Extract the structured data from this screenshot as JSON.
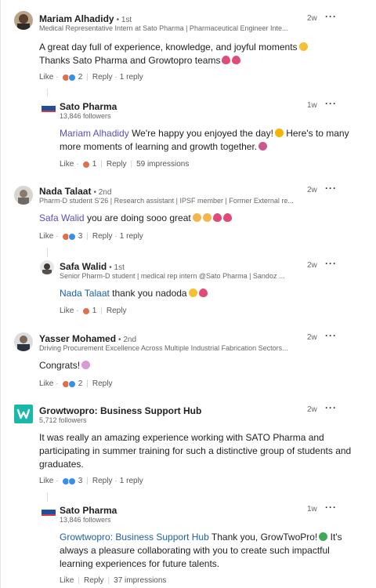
{
  "comments": [
    {
      "name": "Mariam Alhadidy",
      "degree": "• 1st",
      "headline": "Medical Representative Intern at Sato Pharma | Pharmaceutical Engineer Inte...",
      "time": "2w",
      "line1": "A great day full of experience, knowledge, and joyful moments",
      "line2": "Thanks Sato Pharma and Growtopro teams",
      "like": "Like",
      "reaction_count": "2",
      "reply": "Reply",
      "replies": "1 reply"
    },
    {
      "name": "Sato Pharma",
      "headline": "13,846 followers",
      "time": "1w",
      "mention": "Mariam Alhadidy",
      "line1": "We're happy you enjoyed the day!",
      "line1b": "Here's to many",
      "line2": "more moments of learning and growth together.",
      "like": "Like",
      "reaction_count": "1",
      "reply": "Reply",
      "impressions": "59 impressions"
    },
    {
      "name": "Nada Talaat",
      "degree": "• 2nd",
      "headline": "Pharm-D student S'26 | Research assistant | IPSF member | Former External re...",
      "time": "2w",
      "mention": "Safa Walid",
      "line1": "you are doing sooo great",
      "like": "Like",
      "reaction_count": "3",
      "reply": "Reply",
      "replies": "1 reply"
    },
    {
      "name": "Safa Walid",
      "degree": "• 1st",
      "headline": "Senior Pharm-D student | medical rep intern @Sato Pharma | Sandoz ...",
      "time": "2w",
      "mention": "Nada Talaat",
      "line1": "thank you nadoda",
      "like": "Like",
      "reaction_count": "1",
      "reply": "Reply"
    },
    {
      "name": "Yasser Mohamed",
      "degree": "• 2nd",
      "headline": "Driving Procurement Excellence Across Multiple Industrial Fabrication Sectors...",
      "time": "2w",
      "line1": "Congrats!",
      "like": "Like",
      "reaction_count": "2",
      "reply": "Reply"
    },
    {
      "name": "Growtwopro: Business Support Hub",
      "headline": "5,712 followers",
      "time": "2w",
      "line1": "It was really an amazing experience working with SATO Pharma and",
      "line2": "participating in summer training for such a distinctive group of students and",
      "line3": "graduates.",
      "like": "Like",
      "reaction_count": "3",
      "reply": "Reply",
      "replies": "1 reply"
    },
    {
      "name": "Sato Pharma",
      "headline": "13,846 followers",
      "time": "1w",
      "mention": "Growtwopro: Business Support Hub",
      "line1": "Thank you, GrowTwoPro!",
      "line1b": "It's",
      "line2": "always a pleasure collaborating with you to create such impactful",
      "line3": "learning experiences for future talents.",
      "like": "Like",
      "reply": "Reply",
      "impressions": "37 impressions"
    }
  ],
  "colors": {
    "mention_purple": "#5a4fbf",
    "mention_blue": "#1c5fa8",
    "growtwopro_brand": "#19b8a8"
  }
}
